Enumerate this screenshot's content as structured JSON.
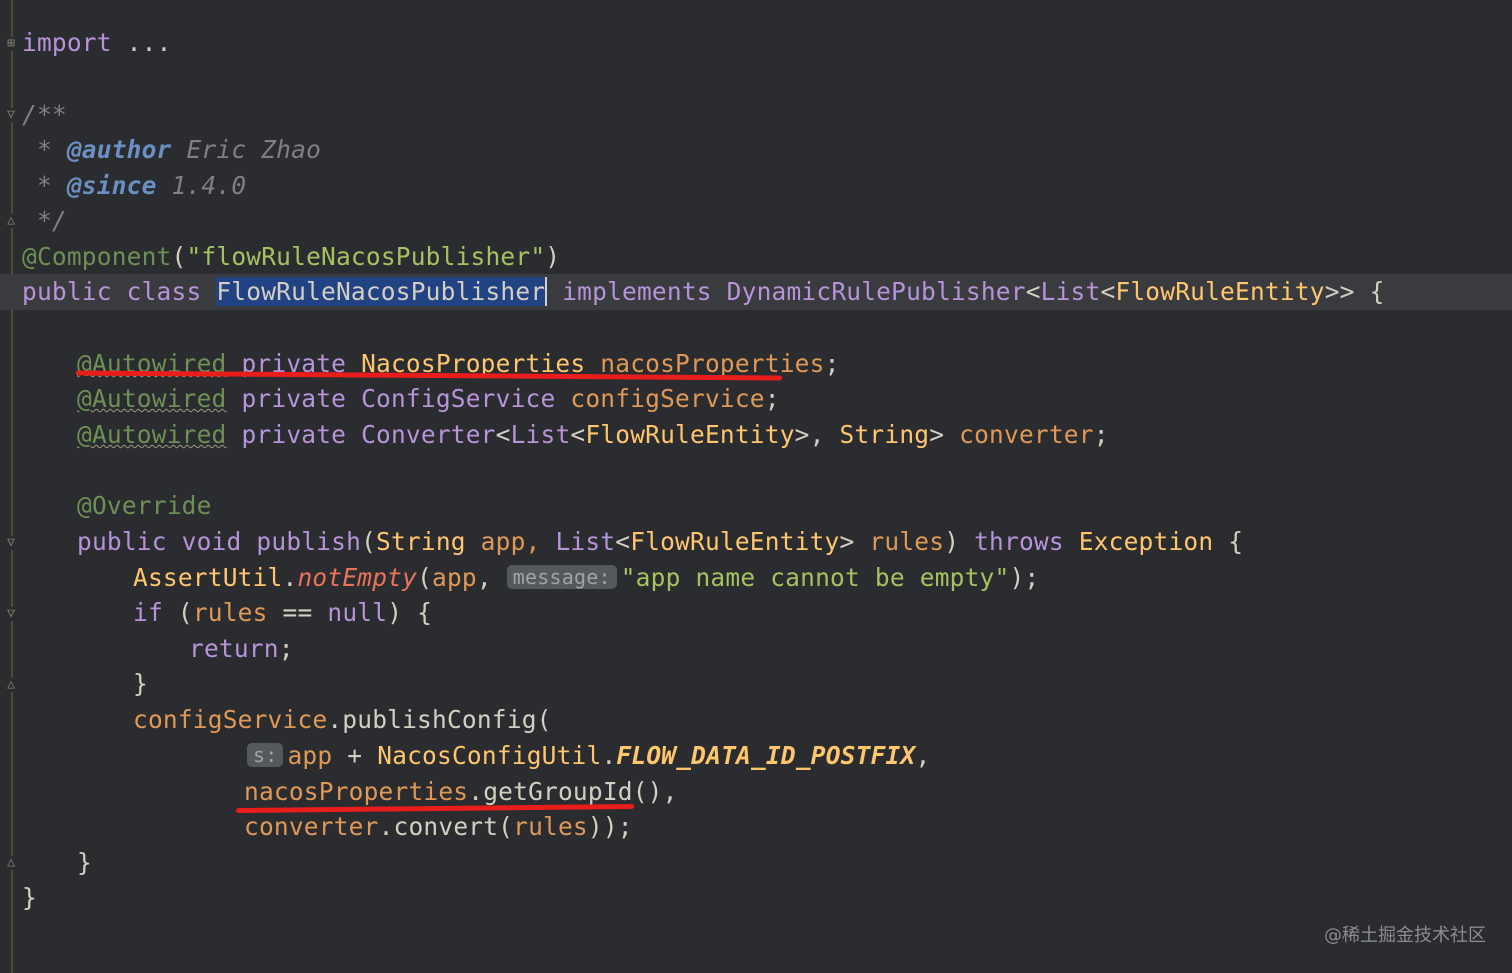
{
  "editor": {
    "lines": {
      "import_kw": "import",
      "import_dots": " ...",
      "doc_open": "/**",
      "doc_author_star": " * ",
      "doc_author_tag": "@author",
      "doc_author_val": " Eric Zhao",
      "doc_since_star": " * ",
      "doc_since_tag": "@since",
      "doc_since_val": " 1.4.0",
      "doc_close": " */",
      "component_ann": "@Component",
      "component_open": "(",
      "component_str": "\"flowRuleNacosPublisher\"",
      "component_close": ")",
      "class_public": "public ",
      "class_class": "class ",
      "class_name": "FlowRuleNacosPublisher",
      "class_implements": " implements ",
      "class_iface": "DynamicRulePublisher",
      "class_lt1": "<",
      "class_list": "List",
      "class_lt2": "<",
      "class_entity": "FlowRuleEntity",
      "class_gt": ">>",
      "class_brace": " {",
      "f1_ann": "@Autowired",
      "f1_private": " private ",
      "f1_type": "NacosProperties",
      "f1_name": " nacosProperties",
      "f1_semi": ";",
      "f2_ann": "@Autowired",
      "f2_private": " private ",
      "f2_type": "ConfigService",
      "f2_name": " configService",
      "f2_semi": ";",
      "f3_ann": "@Autowired",
      "f3_private": " private ",
      "f3_type": "Converter",
      "f3_lt1": "<",
      "f3_list": "List",
      "f3_lt2": "<",
      "f3_entity": "FlowRuleEntity",
      "f3_gt": ">, ",
      "f3_string": "String",
      "f3_gt2": "> ",
      "f3_name": "converter",
      "f3_semi": ";",
      "override": "@Override",
      "m_public": "public ",
      "m_void": "void ",
      "m_name": "publish",
      "m_open": "(",
      "m_string": "String",
      "m_app": " app, ",
      "m_list": "List",
      "m_lt": "<",
      "m_entity": "FlowRuleEntity",
      "m_gt": "> ",
      "m_rules": "rules",
      "m_close": ") ",
      "m_throws": "throws ",
      "m_exception": "Exception",
      "m_brace": " {",
      "assert_cls": "AssertUtil",
      "assert_dot": ".",
      "assert_method": "notEmpty",
      "assert_open": "(",
      "assert_app": "app",
      "assert_comma": ", ",
      "assert_hint": "message:",
      "assert_str": "\"app name cannot be empty\"",
      "assert_close": ");",
      "if_kw": "if ",
      "if_open": "(",
      "if_rules": "rules",
      "if_cmp": " == ",
      "if_null": "null",
      "if_close": ") {",
      "return_kw": "return",
      "return_semi": ";",
      "if_end": "}",
      "pub_field": "configService",
      "pub_call": ".publishConfig(",
      "arg1_hint": "s:",
      "arg1_app": "app",
      "arg1_plus": " + ",
      "arg1_cls": "NacosConfigUtil",
      "arg1_dot": ".",
      "arg1_const": "FLOW_DATA_ID_POSTFIX",
      "arg1_comma": ",",
      "arg2_field": "nacosProperties",
      "arg2_call": ".getGroupId(),",
      "arg3_field": "converter",
      "arg3_call": ".convert(",
      "arg3_rules": "rules",
      "arg3_close": "));",
      "method_end": "}",
      "class_end": "}"
    },
    "annotation_color": "#ea1d1d"
  },
  "watermark": "@稀土掘金技术社区"
}
